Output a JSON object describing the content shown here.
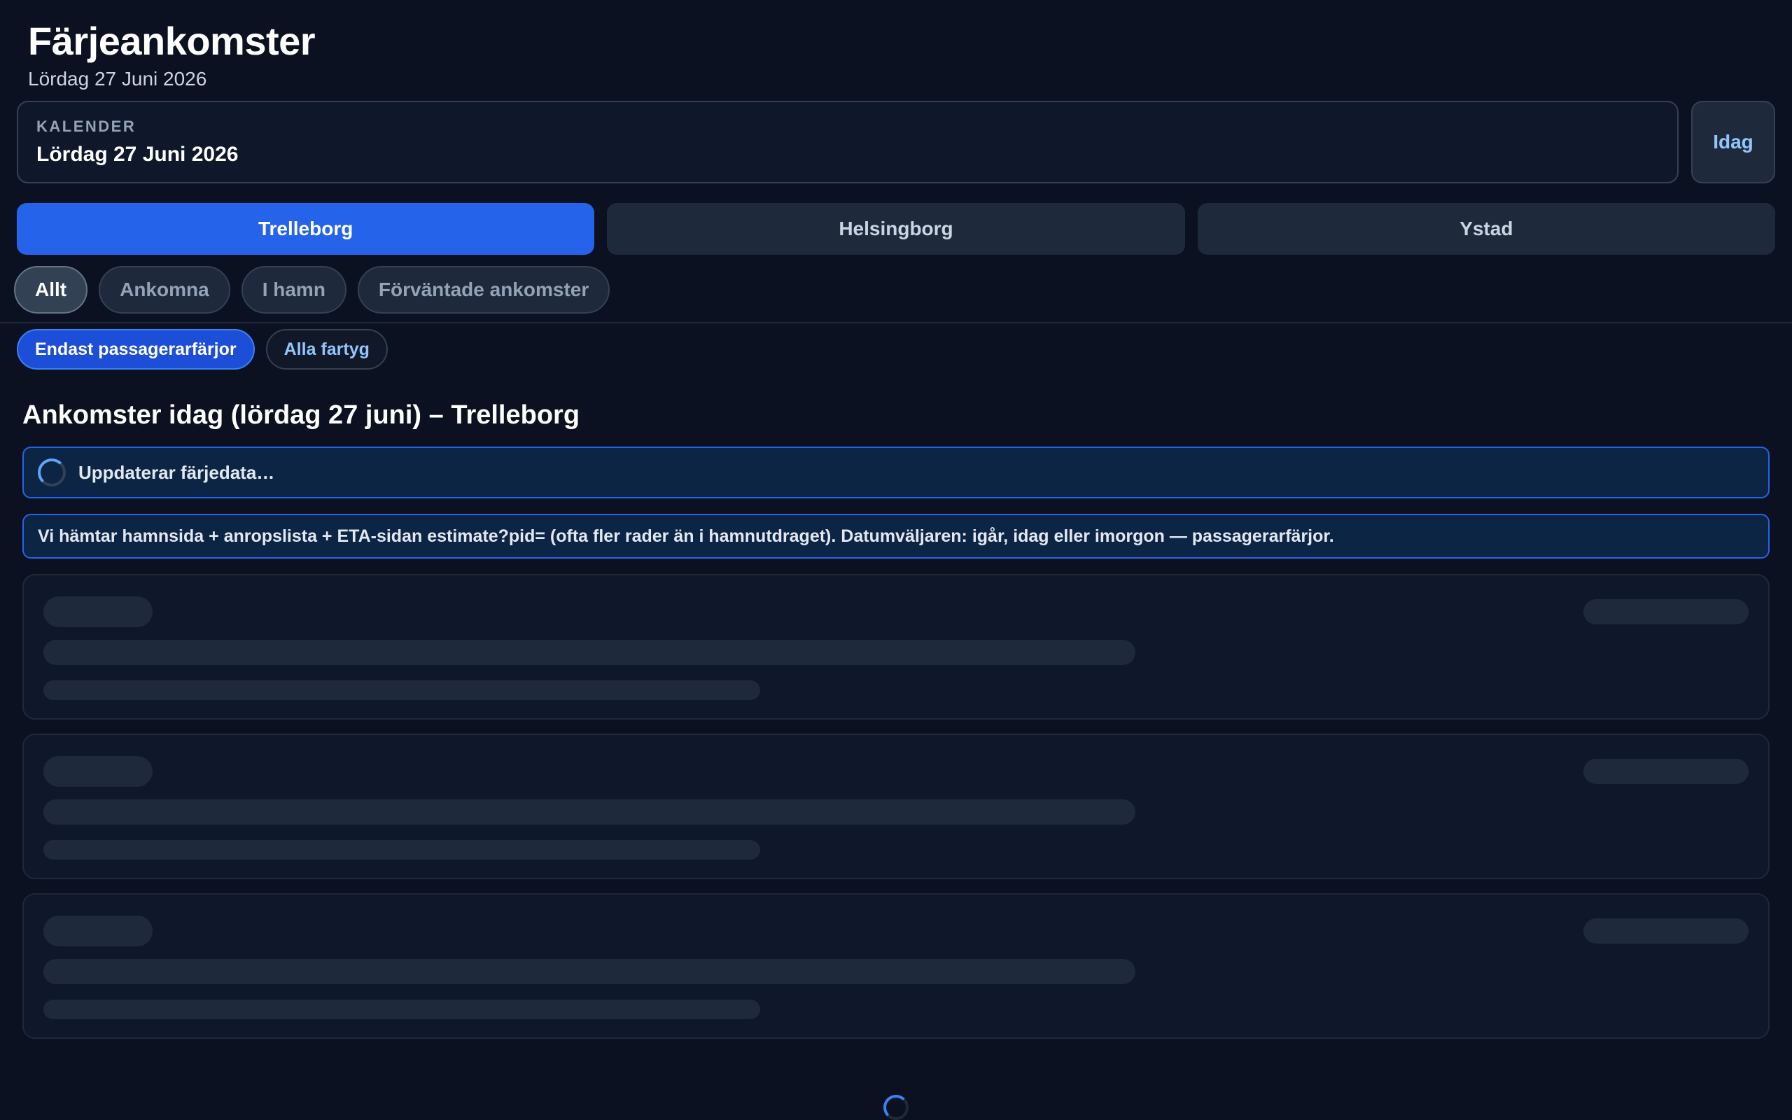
{
  "header": {
    "title": "Färjeankomster",
    "subtitle": "Lördag 27 Juni 2026"
  },
  "calendar": {
    "label": "KALENDER",
    "value": "Lördag 27 Juni 2026",
    "today_label": "Idag"
  },
  "ports": [
    {
      "label": "Trelleborg",
      "active": true
    },
    {
      "label": "Helsingborg",
      "active": false
    },
    {
      "label": "Ystad",
      "active": false
    }
  ],
  "filters": [
    {
      "label": "Allt",
      "active": true
    },
    {
      "label": "Ankomna",
      "active": false
    },
    {
      "label": "I hamn",
      "active": false
    },
    {
      "label": "Förväntade ankomster",
      "active": false
    }
  ],
  "vessel_filters": [
    {
      "label": "Endast passagerarfärjor",
      "active": true
    },
    {
      "label": "Alla fartyg",
      "active": false
    }
  ],
  "section": {
    "title": "Ankomster idag (lördag 27 juni) – Trelleborg"
  },
  "status": {
    "text": "Uppdaterar färjedata…",
    "icon": "loading-spinner-icon"
  },
  "info": {
    "text": "Vi hämtar hamnsida + anropslista + ETA-sidan estimate?pid= (ofta fler rader än i hamnutdraget). Datumväljaren: igår, idag eller imorgon — passagerarfärjor."
  },
  "colors": {
    "background": "#0b1120",
    "accent": "#2563eb",
    "chip_active": "#1d4ed8",
    "link": "#93c5fd"
  }
}
